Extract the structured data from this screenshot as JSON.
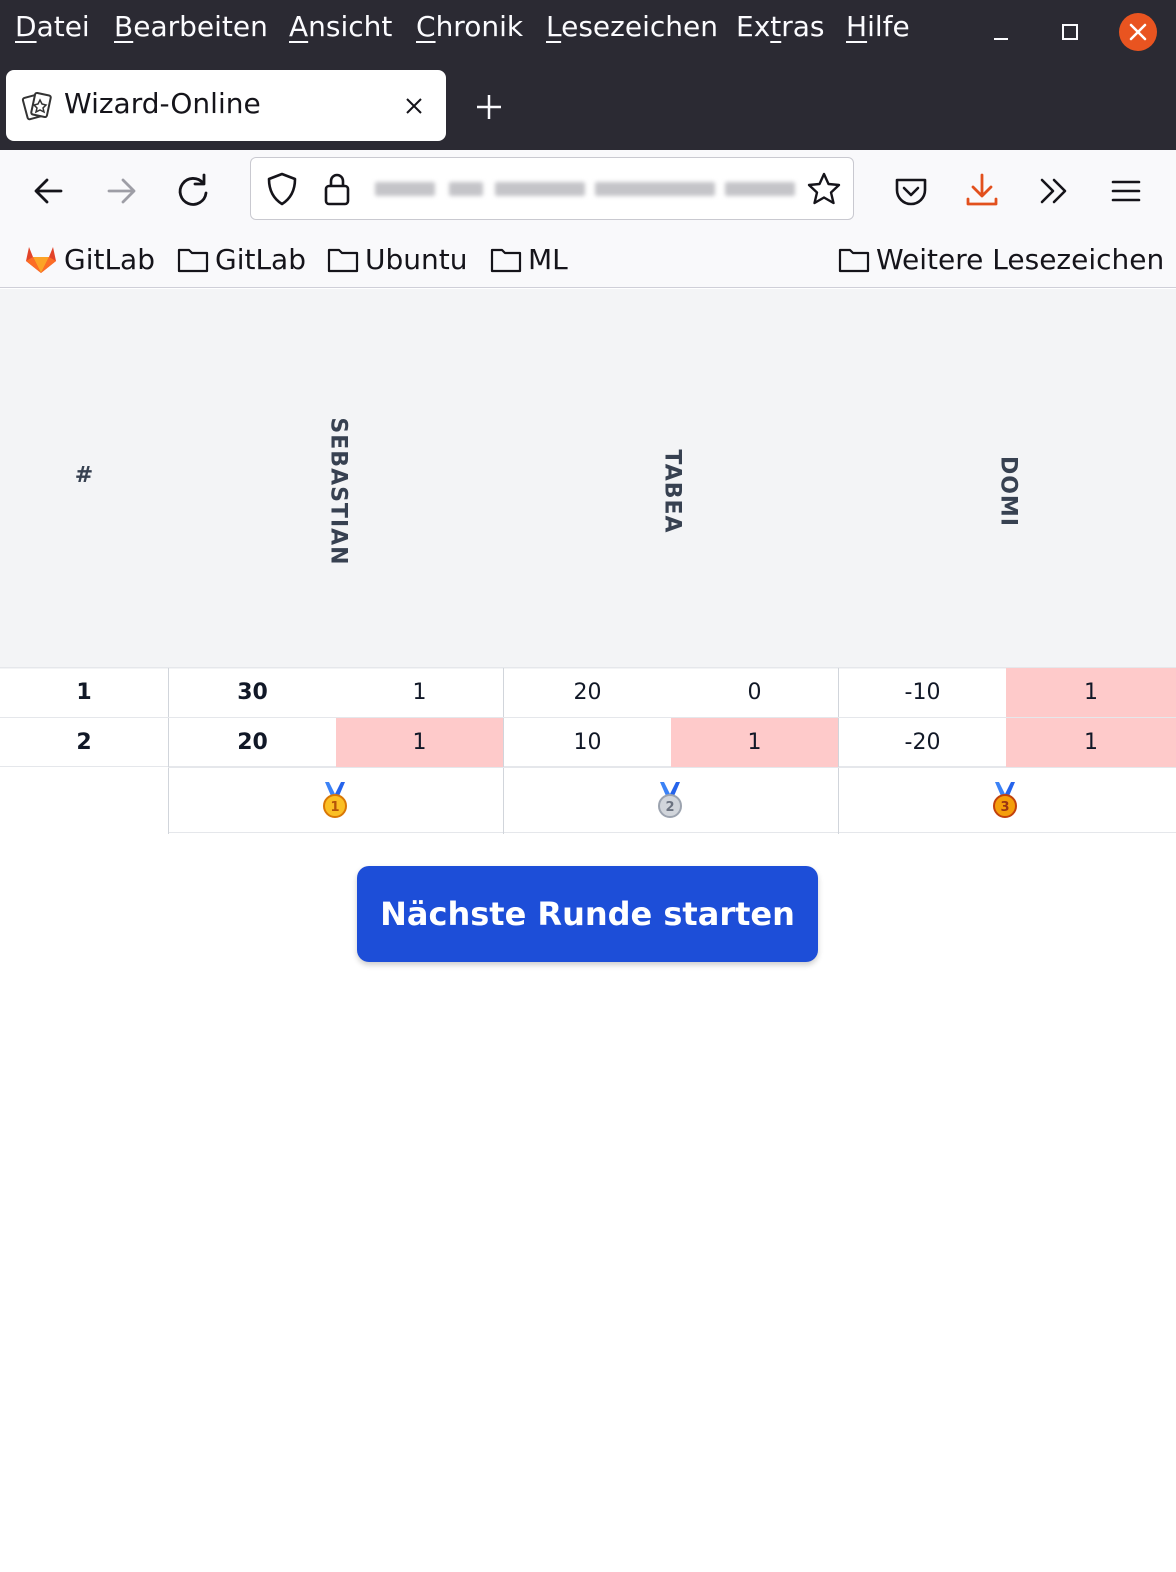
{
  "menu": {
    "items": [
      {
        "accel": "D",
        "rest": "atei"
      },
      {
        "accel": "B",
        "rest": "earbeiten"
      },
      {
        "accel": "A",
        "rest": "nsicht"
      },
      {
        "accel": "C",
        "rest": "hronik"
      },
      {
        "accel": "L",
        "rest": "esezeichen"
      },
      {
        "accel": "",
        "rest": "Ex",
        "accel2": "t",
        "rest2": "ras"
      },
      {
        "accel": "H",
        "rest": "ilfe"
      }
    ]
  },
  "tab": {
    "title": "Wizard-Online"
  },
  "bookmarks": {
    "items": [
      "GitLab",
      "GitLab",
      "Ubuntu",
      "ML"
    ],
    "more": "Weitere Lesezeichen"
  },
  "scoreboard": {
    "header": {
      "round_label": "#",
      "players": [
        "SEBASTIAN",
        "TABEA",
        "DOMI"
      ]
    },
    "rows": [
      {
        "round": "1",
        "cells": [
          {
            "score": "30",
            "bid": "1",
            "missed": false
          },
          {
            "score": "20",
            "bid": "0",
            "missed": false
          },
          {
            "score": "-10",
            "bid": "1",
            "missed": true
          }
        ]
      },
      {
        "round": "2",
        "cells": [
          {
            "score": "20",
            "bid": "1",
            "missed": true
          },
          {
            "score": "10",
            "bid": "1",
            "missed": true
          },
          {
            "score": "-20",
            "bid": "1",
            "missed": true
          }
        ]
      }
    ],
    "medals": [
      "gold-medal-icon",
      "silver-medal-icon",
      "bronze-medal-icon"
    ]
  },
  "actions": {
    "next_round": "Nächste Runde starten"
  },
  "colors": {
    "button": "#1d4ed8",
    "missed_cell": "#fecaca",
    "header_bg": "#f3f4f6",
    "chrome_dark": "#2b2a33",
    "close_button": "#e95420"
  }
}
